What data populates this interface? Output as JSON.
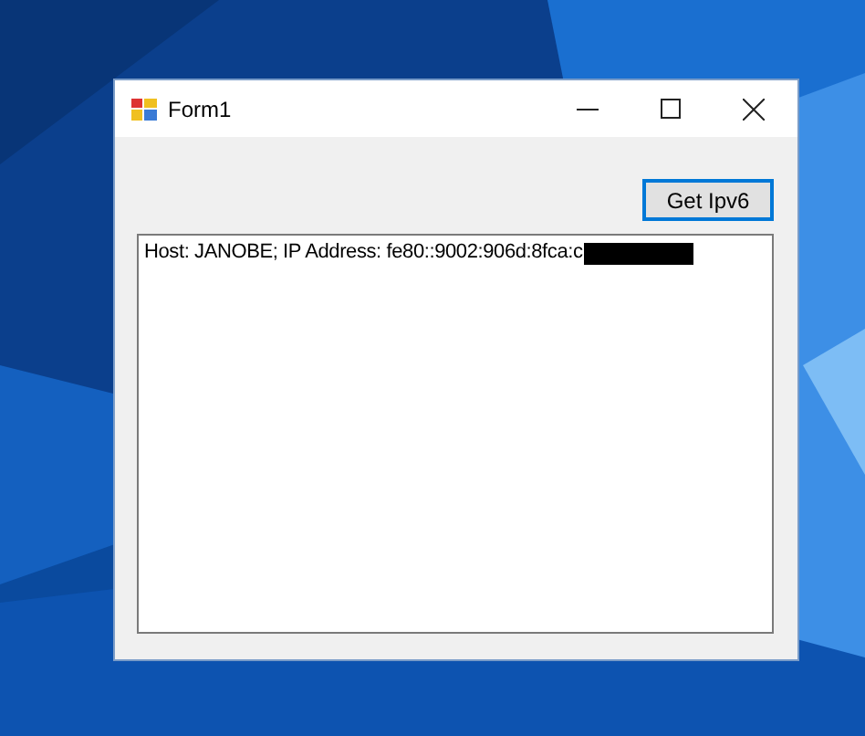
{
  "window": {
    "title": "Form1"
  },
  "button": {
    "label": "Get Ipv6"
  },
  "output": {
    "text": "Host: JANOBE; IP Address: fe80::9002:906d:8fca:c",
    "redacted": true
  }
}
